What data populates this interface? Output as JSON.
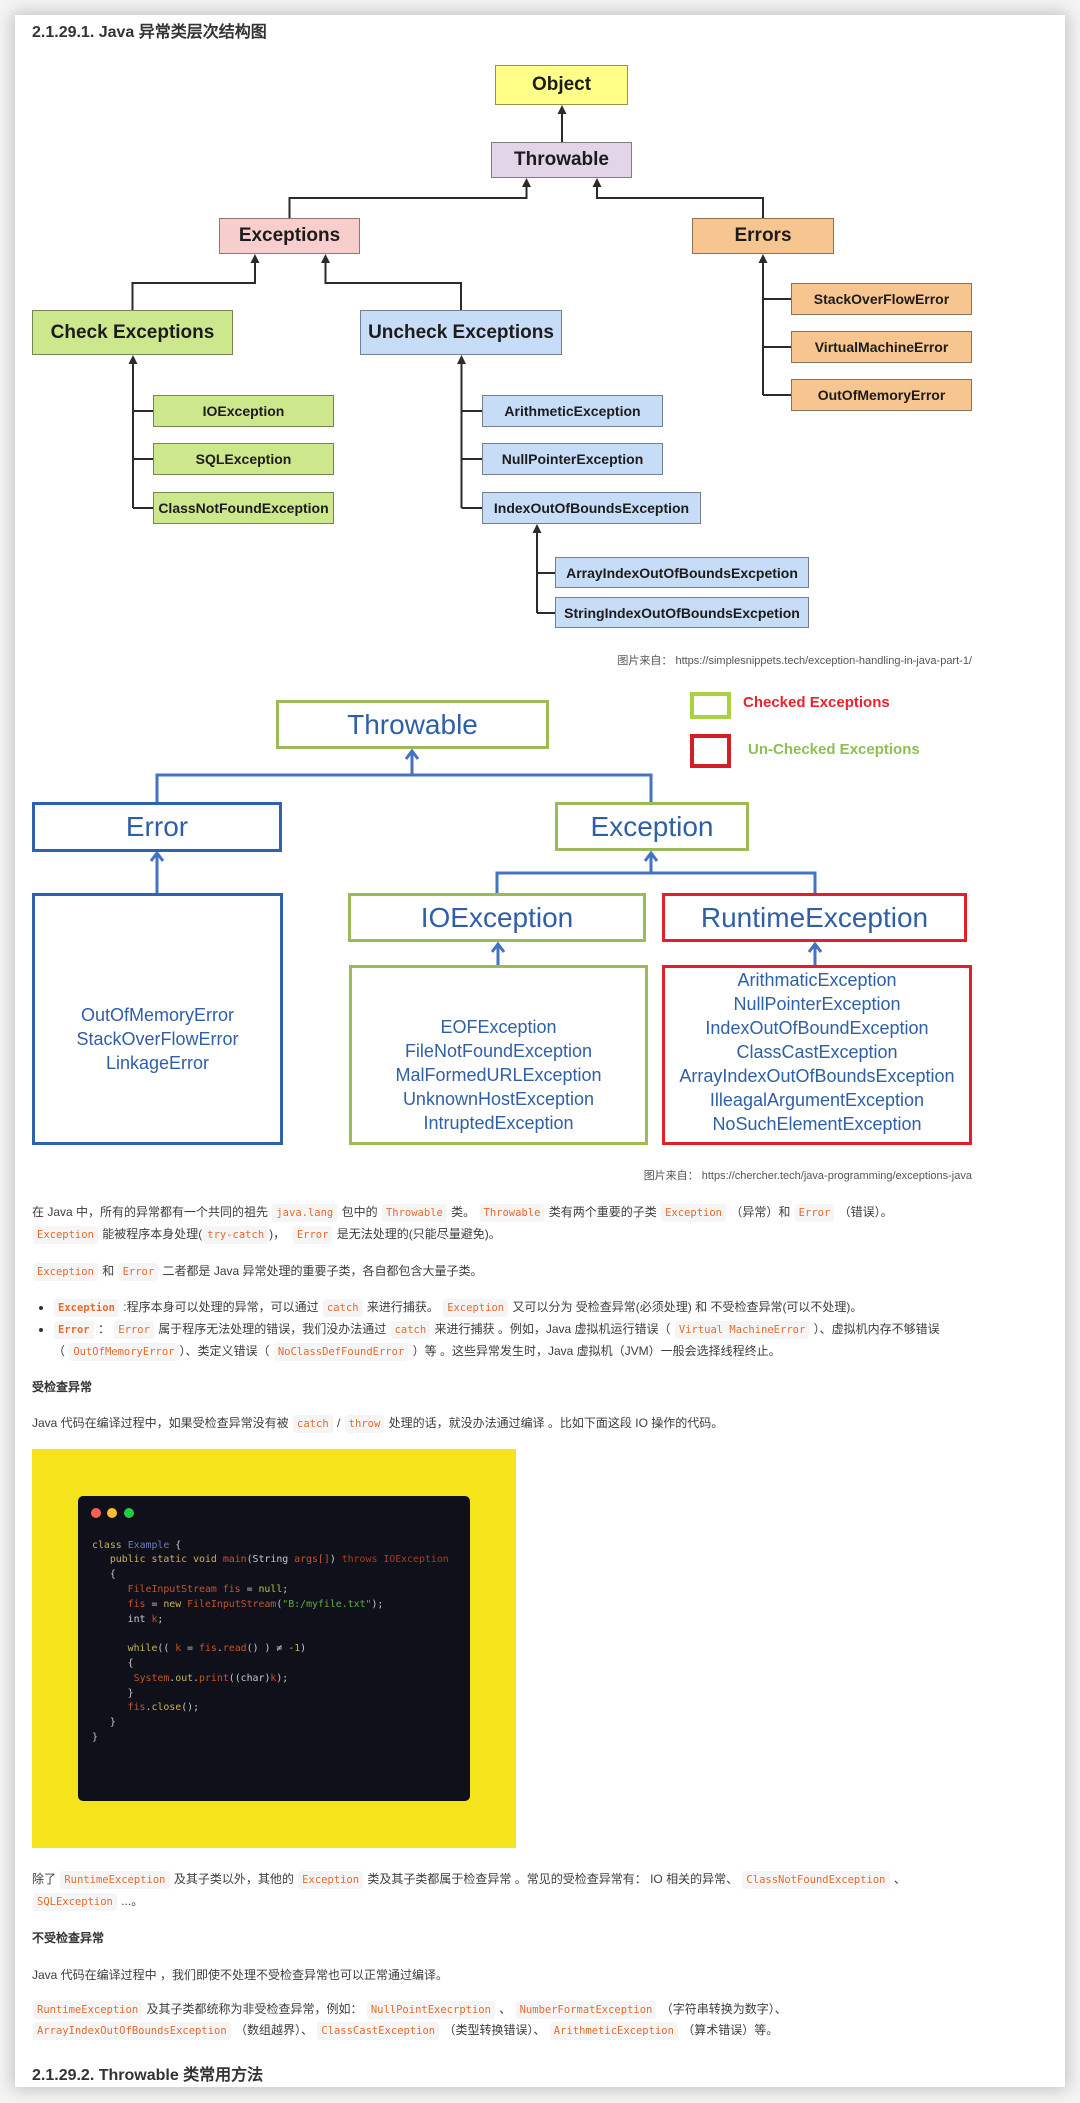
{
  "article": {
    "heading_1": "2.1.29.1. Java 异常类层次结构图",
    "paragraph_1": [
      [
        {
          "t": "在 Java 中，所有的异常都有一个共同的祖先 "
        },
        {
          "c": "java.lang"
        },
        {
          "t": " 包中的 "
        },
        {
          "c": "Throwable"
        },
        {
          "t": " 类。 "
        },
        {
          "c": "Throwable"
        },
        {
          "t": " 类有两个重要的子类 "
        },
        {
          "c": "Exception"
        },
        {
          "t": " （异常）和 "
        },
        {
          "c": "Error"
        },
        {
          "t": " （错误）。"
        }
      ],
      [
        {
          "c": "Exception"
        },
        {
          "t": " 能被程序本身处理("
        },
        {
          "c": "try-catch"
        },
        {
          "t": ")，  "
        },
        {
          "c": "Error"
        },
        {
          "t": " 是无法处理的(只能尽量避免)。"
        }
      ]
    ],
    "paragraph_2": [
      [
        {
          "c": "Exception"
        },
        {
          "t": " 和 "
        },
        {
          "c": "Error"
        },
        {
          "t": " 二者都是 Java 异常处理的重要子类，各自都包含大量子类。"
        }
      ]
    ],
    "bullets": [
      [
        [
          {
            "bc": "Exception"
          },
          {
            "t": " :程序本身可以处理的异常，可以通过 "
          },
          {
            "c": "catch"
          },
          {
            "t": " 来进行捕获。 "
          },
          {
            "c": "Exception"
          },
          {
            "t": " 又可以分为 受检查异常(必须处理) 和 不受检查异常(可以不处理)。"
          }
        ]
      ],
      [
        [
          {
            "bc": "Error"
          },
          {
            "t": " ： "
          },
          {
            "c": "Error"
          },
          {
            "t": " 属于程序无法处理的错误，我们没办法通过 "
          },
          {
            "c": "catch"
          },
          {
            "t": " 来进行捕获 。例如，Java 虚拟机运行错误（ "
          },
          {
            "c": "Virtual MachineError"
          },
          {
            "t": " ）、虚拟机内存不够错误"
          }
        ],
        [
          {
            "t": "（ "
          },
          {
            "c": "OutOfMemoryError"
          },
          {
            "t": "）、类定义错误（ "
          },
          {
            "c": "NoClassDefFoundError"
          },
          {
            "t": " ）等 。这些异常发生时，Java 虚拟机（JVM）一般会选择线程终止。"
          }
        ]
      ]
    ],
    "heading_checked": "受检查异常",
    "paragraph_3": [
      [
        {
          "t": "Java 代码在编译过程中，如果受检查异常没有被 "
        },
        {
          "c": "catch"
        },
        {
          "t": " / "
        },
        {
          "c": "throw"
        },
        {
          "t": " 处理的话，就没办法通过编译 。比如下面这段 IO 操作的代码。"
        }
      ]
    ],
    "paragraph_4": [
      [
        {
          "t": "除了 "
        },
        {
          "c": "RuntimeException"
        },
        {
          "t": " 及其子类以外，其他的 "
        },
        {
          "c": "Exception"
        },
        {
          "t": " 类及其子类都属于检查异常 。常见的受检查异常有： IO 相关的异常、 "
        },
        {
          "c": "ClassNotFoundException"
        },
        {
          "t": " 、"
        }
      ],
      [
        {
          "c": "SQLException"
        },
        {
          "t": " ...。"
        }
      ]
    ],
    "heading_unchecked": "不受检查异常",
    "paragraph_5": [
      [
        {
          "t": "Java 代码在编译过程中 ，我们即使不处理不受检查异常也可以正常通过编译。"
        }
      ]
    ],
    "paragraph_6": [
      [
        {
          "c": "RuntimeException"
        },
        {
          "t": " 及其子类都统称为非受检查异常，例如： "
        },
        {
          "c": "NullPointExecrption"
        },
        {
          "t": " 、 "
        },
        {
          "c": "NumberFormatException"
        },
        {
          "t": " （字符串转换为数字）、"
        }
      ],
      [
        {
          "c": "ArrayIndexOutOfBoundsException"
        },
        {
          "t": " （数组越界）、 "
        },
        {
          "c": "ClassCastException"
        },
        {
          "t": " （类型转换错误）、 "
        },
        {
          "c": "ArithmeticException"
        },
        {
          "t": " （算术错误）等。"
        }
      ]
    ],
    "heading_2": "2.1.29.2. Throwable 类常用方法"
  },
  "diagram1": {
    "nodes": {
      "object": "Object",
      "throwable": "Throwable",
      "exceptions": "Exceptions",
      "errors": "Errors",
      "check_exceptions": "Check Exceptions",
      "uncheck_exceptions": "Uncheck Exceptions",
      "io_exception": "IOException",
      "sql_exception": "SQLException",
      "class_not_found_exception": "ClassNotFoundException",
      "arithmetic_exception": "ArithmeticException",
      "null_pointer_exception": "NullPointerException",
      "index_out_of_bounds_exception": "IndexOutOfBoundsException",
      "array_index_out_of_bounds": "ArrayIndexOutOfBoundsExcpetion",
      "string_index_out_of_bounds": "StringIndexOutOfBoundsExcpetion",
      "stack_overflow_error": "StackOverFlowError",
      "virtual_machine_error": "VirtualMachineError",
      "out_of_memory_error": "OutOfMemoryError"
    },
    "colors": {
      "object": "#ffff88",
      "throwable": "#e1d5e7",
      "exceptions": "#f8cecc",
      "errors": "#f7c58f",
      "checked": "#cde78c",
      "unchecked": "#c7dcf6",
      "connector": "#2b2b2b"
    },
    "caption": "图片来自： https://simplesnippets.tech/exception-handling-in-java-part-1/"
  },
  "diagram2": {
    "legend": [
      {
        "label": "Checked Exceptions",
        "swatch_color": "#a9d241",
        "label_color": "#e8232b"
      },
      {
        "label": "Un-Checked Exceptions",
        "swatch_color": "#d21f27",
        "label_color": "#8cc152"
      }
    ],
    "nodes": {
      "throwable": "Throwable",
      "error": "Error",
      "exception": "Exception",
      "io_exception": "IOException",
      "runtime_exception": "RuntimeException"
    },
    "error_children": [
      "OutOfMemoryError",
      "StackOverFlowError",
      "LinkageError"
    ],
    "io_exception_children": [
      "EOFException",
      "FileNotFoundException",
      "MalFormedURLException",
      "UnknownHostException",
      "IntruptedException"
    ],
    "runtime_exception_children": [
      "ArithmaticException",
      "NullPointerException",
      "IndexOutOfBoundException",
      "ClassCastException",
      "ArrayIndexOutOfBoundsException",
      "IlleagalArgumentException",
      "NoSuchElementException"
    ],
    "colors": {
      "text": "#2f5fa6",
      "connector": "#4472c4",
      "error_border": "#2f62ad",
      "checked_border": "#9bbb59",
      "unchecked_border": "#e0212a"
    },
    "caption": "图片来自： https://chercher.tech/java-programming/exceptions-java"
  },
  "code_image": {
    "background": "#f5e31c",
    "panel": "#0f1019",
    "window_dots": [
      "#ff5f57",
      "#febc2e",
      "#28c840"
    ],
    "palette": {
      "kw": "#c9b25a",
      "cls": "#6b7fb3",
      "fn": "#c4532c",
      "var": "#c4532c",
      "exc": "#a83d24",
      "lit": "#b3c43a",
      "str": "#5fae45",
      "punc": "#c8c8c8"
    },
    "lines": [
      [
        [
          "class",
          "kw"
        ],
        [
          " ",
          "punc"
        ],
        [
          "Example",
          "cls"
        ],
        [
          " {",
          "punc"
        ]
      ],
      [
        [
          "   ",
          "punc"
        ],
        [
          "public static void",
          "kw"
        ],
        [
          " ",
          "punc"
        ],
        [
          "main",
          "fn"
        ],
        [
          "(String ",
          "punc"
        ],
        [
          "args[]",
          "var"
        ],
        [
          ") ",
          "punc"
        ],
        [
          "throws IOException",
          "exc"
        ]
      ],
      [
        [
          "   {",
          "punc"
        ]
      ],
      [
        [
          "      ",
          "punc"
        ],
        [
          "FileInputStream fis",
          "var"
        ],
        [
          " = ",
          "punc"
        ],
        [
          "null",
          "lit"
        ],
        [
          ";",
          "punc"
        ]
      ],
      [
        [
          "      ",
          "punc"
        ],
        [
          "fis",
          "var"
        ],
        [
          " = ",
          "punc"
        ],
        [
          "new",
          "kw"
        ],
        [
          " ",
          "punc"
        ],
        [
          "FileInputStream",
          "var"
        ],
        [
          "(",
          "punc"
        ],
        [
          "\"B:/myfile.txt\"",
          "str"
        ],
        [
          ");",
          "punc"
        ]
      ],
      [
        [
          "      ",
          "punc"
        ],
        [
          "int",
          "punc"
        ],
        [
          " ",
          "punc"
        ],
        [
          "k",
          "var"
        ],
        [
          ";",
          "punc"
        ]
      ],
      [],
      [
        [
          "      ",
          "punc"
        ],
        [
          "while",
          "kw"
        ],
        [
          "(( ",
          "punc"
        ],
        [
          "k",
          "var"
        ],
        [
          " = ",
          "punc"
        ],
        [
          "fis",
          "var"
        ],
        [
          ".",
          "punc"
        ],
        [
          "read",
          "var"
        ],
        [
          "() ) ≠ ",
          "punc"
        ],
        [
          "-1",
          "kw"
        ],
        [
          ")",
          "punc"
        ]
      ],
      [
        [
          "      {",
          "punc"
        ]
      ],
      [
        [
          "       ",
          "punc"
        ],
        [
          "System",
          "var"
        ],
        [
          ".",
          "punc"
        ],
        [
          "out",
          "kw"
        ],
        [
          ".",
          "punc"
        ],
        [
          "print",
          "var"
        ],
        [
          "((char)",
          "punc"
        ],
        [
          "k",
          "var"
        ],
        [
          ");",
          "punc"
        ]
      ],
      [
        [
          "      }",
          "punc"
        ]
      ],
      [
        [
          "      ",
          "punc"
        ],
        [
          "fis",
          "var"
        ],
        [
          ".",
          "punc"
        ],
        [
          "close",
          "kw"
        ],
        [
          "();",
          "punc"
        ]
      ],
      [
        [
          "   }",
          "punc"
        ]
      ],
      [
        [
          "}",
          "punc"
        ]
      ]
    ]
  }
}
